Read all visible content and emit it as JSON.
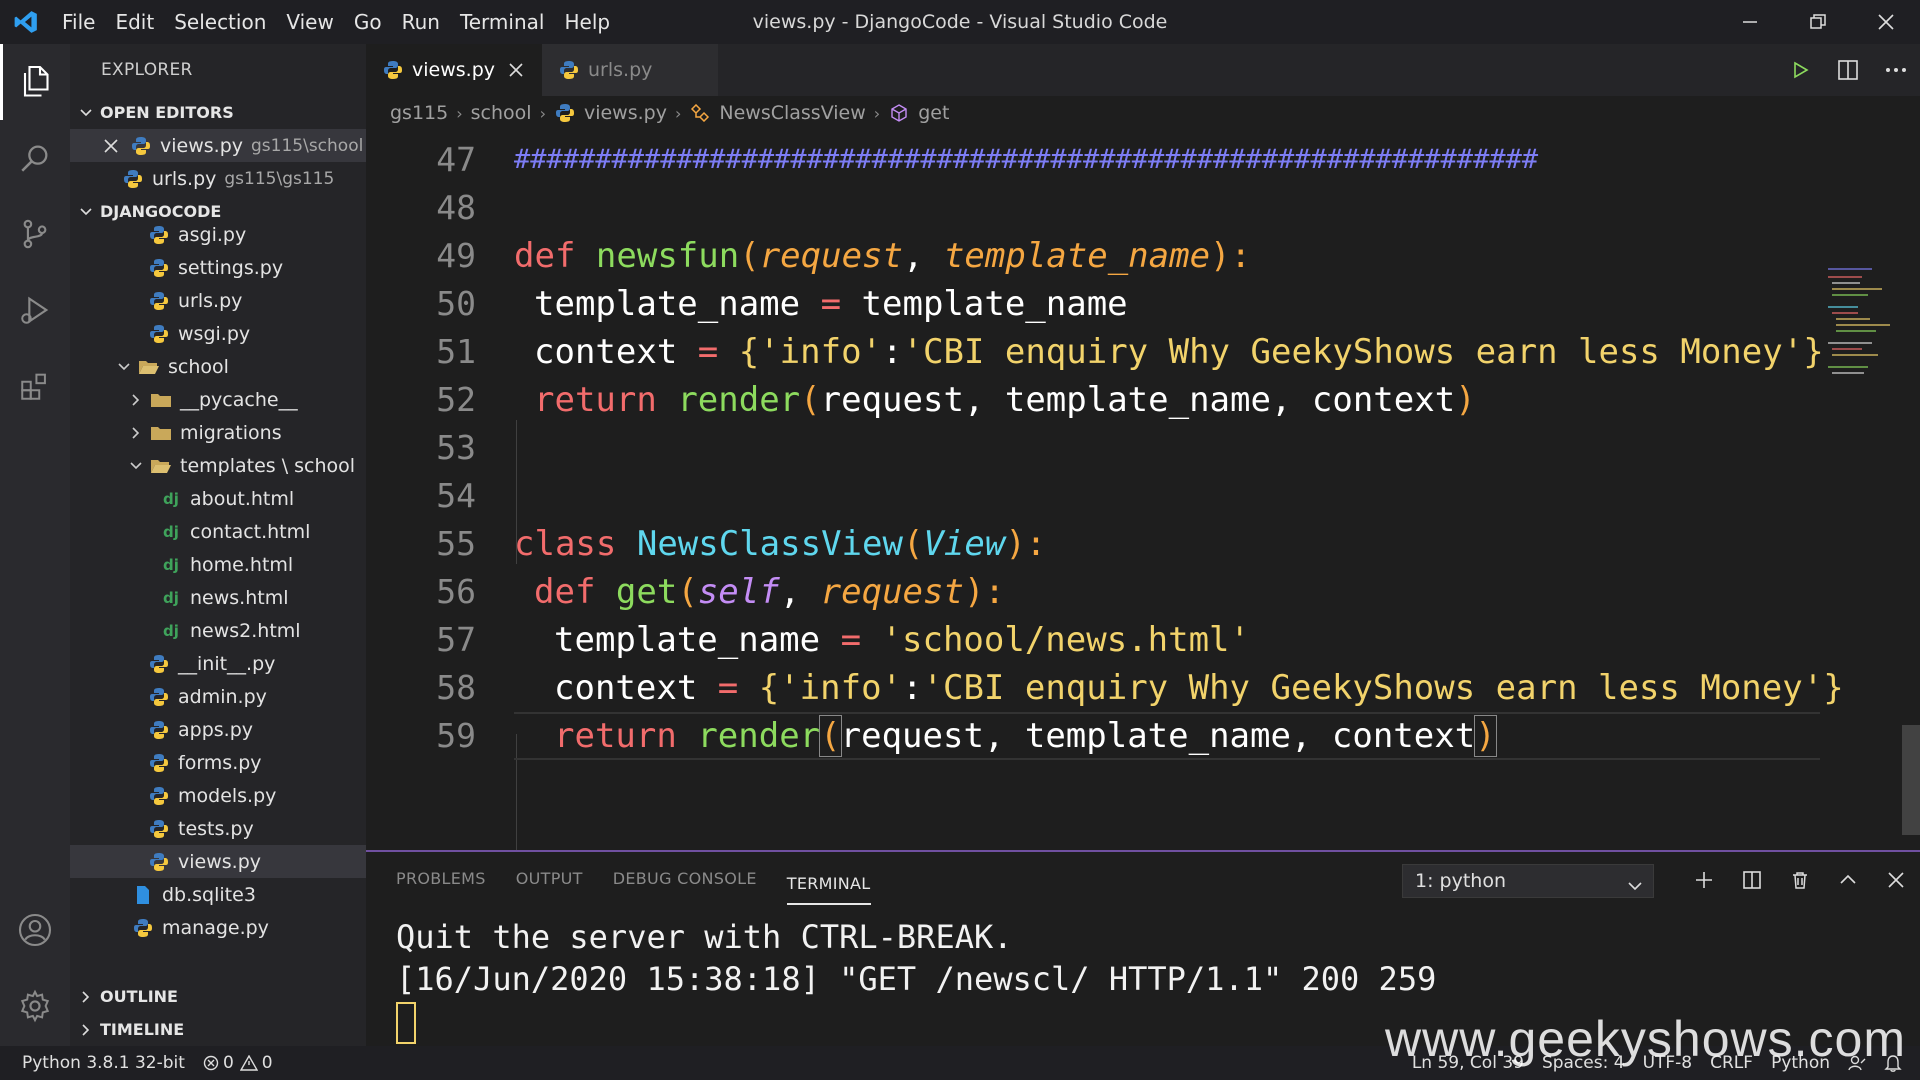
{
  "titlebar": {
    "menu": [
      "File",
      "Edit",
      "Selection",
      "View",
      "Go",
      "Run",
      "Terminal",
      "Help"
    ],
    "window_title": "views.py - DjangoCode - Visual Studio Code"
  },
  "sidebar": {
    "title": "EXPLORER",
    "open_editors_label": "OPEN EDITORS",
    "open_editors": [
      {
        "name": "views.py",
        "path": "gs115\\school"
      },
      {
        "name": "urls.py",
        "path": "gs115\\gs115"
      }
    ],
    "project_label": "DJANGOCODE",
    "tree": {
      "asgi": "asgi.py",
      "settings": "settings.py",
      "urls": "urls.py",
      "wsgi": "wsgi.py",
      "school": "school",
      "pycache": "__pycache__",
      "migrations": "migrations",
      "templates": "templates \\ school",
      "about": "about.html",
      "contact": "contact.html",
      "home": "home.html",
      "news": "news.html",
      "news2": "news2.html",
      "init": "__init__.py",
      "admin": "admin.py",
      "apps": "apps.py",
      "forms": "forms.py",
      "models": "models.py",
      "tests": "tests.py",
      "views": "views.py",
      "db": "db.sqlite3",
      "manage": "manage.py"
    },
    "outline_label": "OUTLINE",
    "timeline_label": "TIMELINE"
  },
  "tabs": [
    {
      "label": "views.py"
    },
    {
      "label": "urls.py"
    }
  ],
  "breadcrumb": [
    "gs115",
    "school",
    "views.py",
    "NewsClassView",
    "get"
  ],
  "code": {
    "l47": {
      "num": "47",
      "hash": "###############################################################"
    },
    "l48": {
      "num": "48"
    },
    "l49": {
      "num": "49",
      "kw": "def",
      "fn": "newsfun",
      "open": "(",
      "p1": "request",
      "comma": ", ",
      "p2": "template_name",
      "close": "):"
    },
    "l50": {
      "num": "50",
      "lhs": "template_name",
      "eq": " = ",
      "rhs": "template_name"
    },
    "l51": {
      "num": "51",
      "lhs": "context",
      "eq": " = ",
      "open": "{",
      "s1": "'info'",
      "colon": ":",
      "s2": "'CBI enquiry Why GeekyShows earn less Money'",
      "close": "}"
    },
    "l52": {
      "num": "52",
      "kw": "return",
      "fn": "render",
      "open": "(",
      "args": "request, template_name, context",
      "close": ")"
    },
    "l53": {
      "num": "53"
    },
    "l54": {
      "num": "54"
    },
    "l55": {
      "num": "55",
      "kw": "class",
      "cls": "NewsClassView",
      "open": "(",
      "base": "View",
      "close": "):"
    },
    "l56": {
      "num": "56",
      "kw": "def",
      "fn": "get",
      "open": "(",
      "p1": "self",
      "comma": ", ",
      "p2": "request",
      "close": "):"
    },
    "l57": {
      "num": "57",
      "lhs": "template_name",
      "eq": " = ",
      "str": "'school/news.html'"
    },
    "l58": {
      "num": "58",
      "lhs": "context",
      "eq": " = ",
      "open": "{",
      "s1": "'info'",
      "colon": ":",
      "s2": "'CBI enquiry Why GeekyShows earn less Money'",
      "close": "}"
    },
    "l59": {
      "num": "59",
      "kw": "return",
      "fn": "render",
      "open": "(",
      "args": "request, template_name, context",
      "close": ")"
    }
  },
  "panel": {
    "tabs": [
      "PROBLEMS",
      "OUTPUT",
      "DEBUG CONSOLE",
      "TERMINAL"
    ],
    "terminal_select": "1: python",
    "terminal_lines": [
      "Quit the server with CTRL-BREAK.",
      "[16/Jun/2020 15:38:18] \"GET /newscl/ HTTP/1.1\" 200 259"
    ]
  },
  "statusbar": {
    "interpreter": "Python 3.8.1 32-bit",
    "errors": "0",
    "warnings": "0",
    "position": "Ln 59, Col 39",
    "spaces": "Spaces: 4",
    "encoding": "UTF-8",
    "eol": "CRLF",
    "language": "Python"
  },
  "watermark": "www.geekyshows.com",
  "colors": {
    "accent": "#007acc",
    "keyword": "#f26c6c",
    "function": "#8ddb5e",
    "class": "#5fd7ee",
    "string": "#f2d36b"
  }
}
